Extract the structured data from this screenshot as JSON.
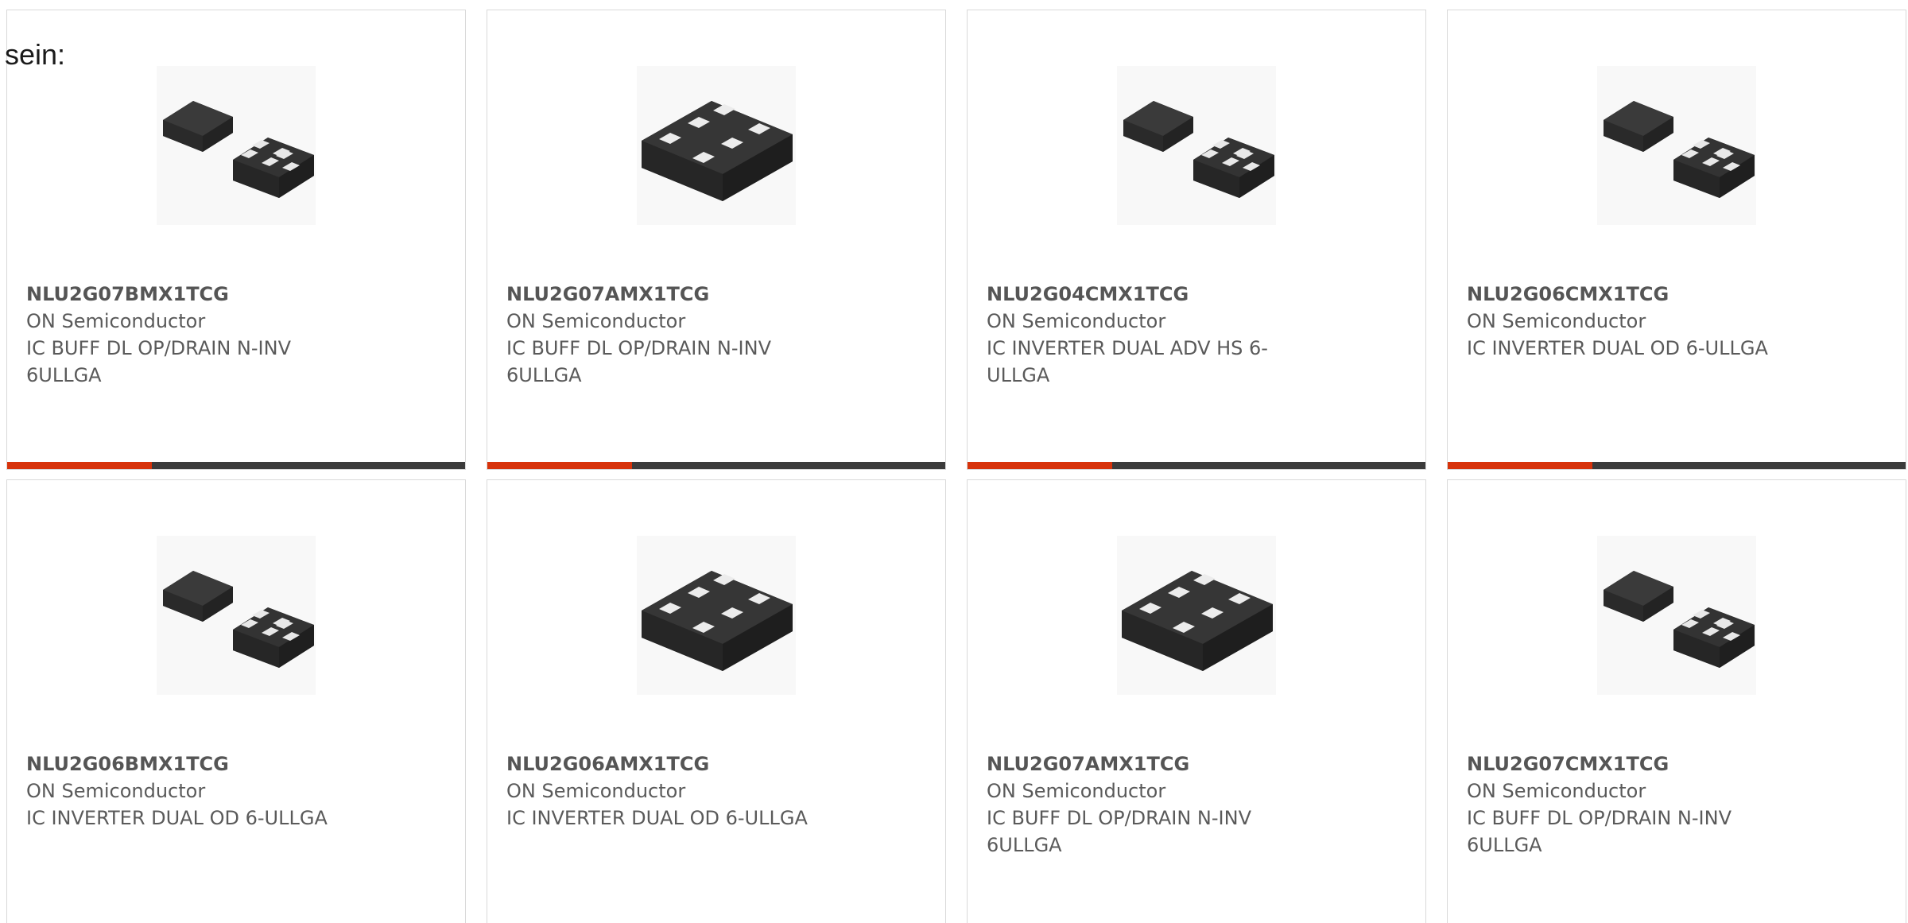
{
  "lead_text": "sein:",
  "colors": {
    "accent": "#d7330b",
    "bar": "#3b3b3b",
    "border": "#d9d9d9",
    "text": "#555555"
  },
  "products": [
    {
      "part_number": "NLU2G07BMX1TCG",
      "manufacturer": "ON Semiconductor",
      "description": "IC BUFF DL OP/DRAIN N-INV 6ULLGA",
      "image": "chip-pair-icon"
    },
    {
      "part_number": "NLU2G07AMX1TCG",
      "manufacturer": "ON Semiconductor",
      "description": "IC BUFF DL OP/DRAIN N-INV 6ULLGA",
      "image": "chip-single-icon"
    },
    {
      "part_number": "NLU2G04CMX1TCG",
      "manufacturer": "ON Semiconductor",
      "description": "IC INVERTER DUAL ADV HS 6-ULLGA",
      "image": "chip-pair-icon"
    },
    {
      "part_number": "NLU2G06CMX1TCG",
      "manufacturer": "ON Semiconductor",
      "description": "IC INVERTER DUAL OD 6-ULLGA",
      "image": "chip-pair-icon"
    },
    {
      "part_number": "NLU2G06BMX1TCG",
      "manufacturer": "ON Semiconductor",
      "description": "IC INVERTER DUAL OD 6-ULLGA",
      "image": "chip-pair-icon"
    },
    {
      "part_number": "NLU2G06AMX1TCG",
      "manufacturer": "ON Semiconductor",
      "description": "IC INVERTER DUAL OD 6-ULLGA",
      "image": "chip-single-icon"
    },
    {
      "part_number": "NLU2G07AMX1TCG",
      "manufacturer": "ON Semiconductor",
      "description": "IC BUFF DL OP/DRAIN N-INV 6ULLGA",
      "image": "chip-single-icon"
    },
    {
      "part_number": "NLU2G07CMX1TCG",
      "manufacturer": "ON Semiconductor",
      "description": "IC BUFF DL OP/DRAIN N-INV 6ULLGA",
      "image": "chip-pair-icon"
    }
  ]
}
